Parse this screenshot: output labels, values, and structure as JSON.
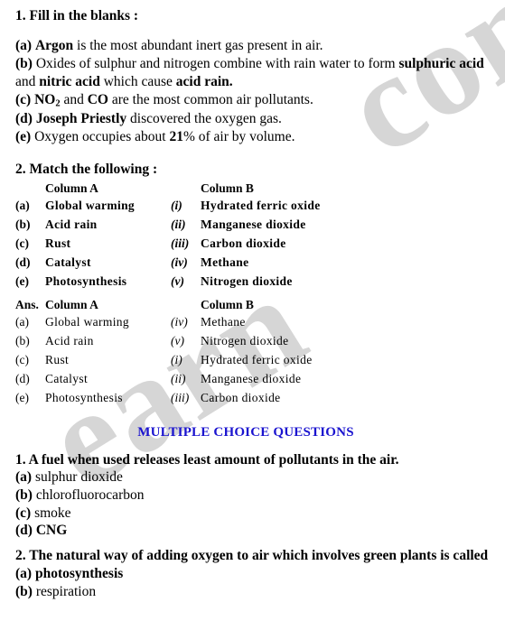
{
  "watermark": {
    "right_text": "com",
    "left_text": "earn"
  },
  "fill_in_blanks": {
    "heading": "1. Fill in the blanks :",
    "items": [
      {
        "label": "(a)",
        "parts": [
          {
            "text": "Argon",
            "bold": true
          },
          {
            "text": " is the most abundant inert gas present in air.",
            "bold": false
          }
        ]
      },
      {
        "label": "(b)",
        "parts": [
          {
            "text": " Oxides of sulphur and nitrogen combine with rain water to form ",
            "bold": false
          },
          {
            "text": "sulphuric acid",
            "bold": true
          },
          {
            "text": " and ",
            "bold": false
          },
          {
            "text": "nitric acid",
            "bold": true
          },
          {
            "text": " which cause ",
            "bold": false
          },
          {
            "text": "acid rain.",
            "bold": true
          }
        ]
      },
      {
        "label": "(c)",
        "parts": [
          {
            "text": "NO",
            "bold": true,
            "sub": "2"
          },
          {
            "text": " and ",
            "bold": false
          },
          {
            "text": "CO",
            "bold": true
          },
          {
            "text": " are the most common air pollutants.",
            "bold": false
          }
        ]
      },
      {
        "label": "(d)",
        "parts": [
          {
            "text": "Joseph Priestly",
            "bold": true
          },
          {
            "text": " discovered the oxygen gas.",
            "bold": false
          }
        ]
      },
      {
        "label": "(e)",
        "parts": [
          {
            "text": " Oxygen occupies about ",
            "bold": false
          },
          {
            "text": "21",
            "bold": true
          },
          {
            "text": "% of air by volume.",
            "bold": false
          }
        ]
      }
    ]
  },
  "match_following": {
    "heading": "2. Match the following :",
    "question": {
      "column_a_header": "Column A",
      "column_b_header": "Column B",
      "rows": [
        {
          "a_label": "(a)",
          "a_text": "Global warming",
          "b_label": "(i)",
          "b_text": "Hydrated ferric oxide"
        },
        {
          "a_label": "(b)",
          "a_text": "Acid rain",
          "b_label": "(ii)",
          "b_text": "Manganese dioxide"
        },
        {
          "a_label": "(c)",
          "a_text": "Rust",
          "b_label": "(iii)",
          "b_text": "Carbon dioxide"
        },
        {
          "a_label": "(d)",
          "a_text": "Catalyst",
          "b_label": "(iv)",
          "b_text": "Methane"
        },
        {
          "a_label": "(e)",
          "a_text": "Photosynthesis",
          "b_label": "(v)",
          "b_text": "Nitrogen dioxide"
        }
      ]
    },
    "answer": {
      "ans_label": "Ans.",
      "column_a_header": "Column A",
      "column_b_header": "Column B",
      "rows": [
        {
          "a_label": "(a)",
          "a_text": "Global warming",
          "b_label": "(iv)",
          "b_text": "Methane"
        },
        {
          "a_label": "(b)",
          "a_text": "Acid rain",
          "b_label": "(v)",
          "b_text": "Nitrogen dioxide"
        },
        {
          "a_label": "(c)",
          "a_text": "Rust",
          "b_label": "(i)",
          "b_text": "Hydrated ferric oxide"
        },
        {
          "a_label": "(d)",
          "a_text": "Catalyst",
          "b_label": "(ii)",
          "b_text": "Manganese dioxide"
        },
        {
          "a_label": "(e)",
          "a_text": "Photosynthesis",
          "b_label": "(iii)",
          "b_text": "Carbon dioxide"
        }
      ]
    }
  },
  "mcq": {
    "heading": "MULTIPLE CHOICE QUESTIONS",
    "heading_color": "#1a13cf",
    "questions": [
      {
        "question": "1. A fuel when used releases least amount of pollutants in the air.",
        "options": [
          {
            "label": "(a)",
            "text": " sulphur dioxide",
            "is_answer": false
          },
          {
            "label": "(b)",
            "text": " chlorofluorocarbon",
            "is_answer": false
          },
          {
            "label": "(c)",
            "text": " smoke",
            "is_answer": false
          },
          {
            "label": "(d)",
            "text": " CNG",
            "is_answer": true
          }
        ]
      },
      {
        "question": "2. The natural way of adding oxygen to air which involves green plants is called",
        "options": [
          {
            "label": "(a)",
            "text": " photosynthesis",
            "is_answer": true
          },
          {
            "label": "(b)",
            "text": " respiration",
            "is_answer": false
          }
        ]
      }
    ]
  }
}
